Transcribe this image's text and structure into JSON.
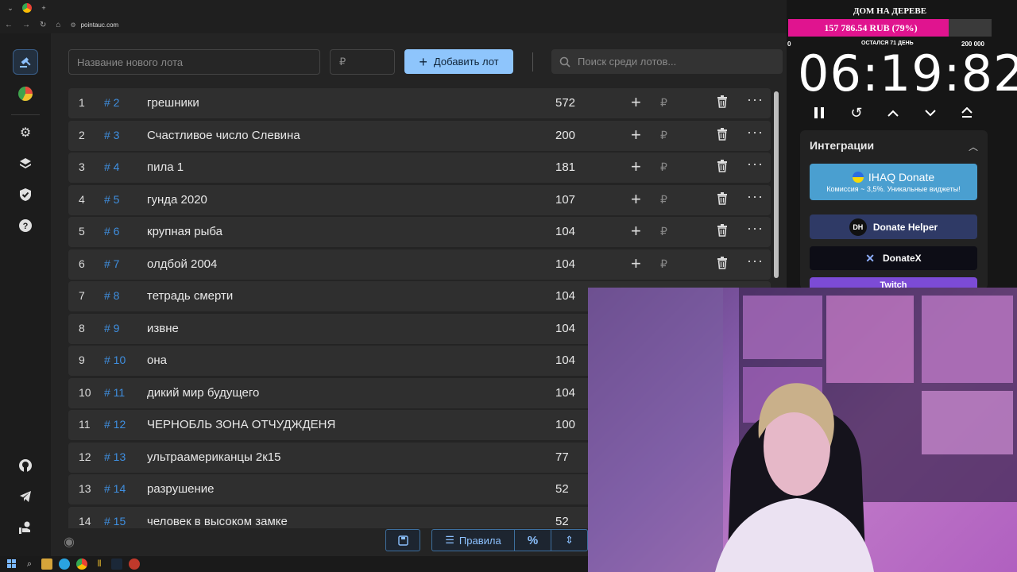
{
  "browser": {
    "url": "pointauc.com"
  },
  "form": {
    "lot_name_placeholder": "Название нового лота",
    "price_placeholder": "₽",
    "add_button_label": "Добавить лот",
    "search_placeholder": "Поиск среди лотов..."
  },
  "lots": [
    {
      "num": "1",
      "id": "# 2",
      "name": "грешники",
      "amount": "572"
    },
    {
      "num": "2",
      "id": "# 3",
      "name": "Счастливое число Слевина",
      "amount": "200"
    },
    {
      "num": "3",
      "id": "# 4",
      "name": "пила 1",
      "amount": "181"
    },
    {
      "num": "4",
      "id": "# 5",
      "name": "гунда 2020",
      "amount": "107"
    },
    {
      "num": "5",
      "id": "# 6",
      "name": "крупная рыба",
      "amount": "104"
    },
    {
      "num": "6",
      "id": "# 7",
      "name": "олдбой 2004",
      "amount": "104"
    },
    {
      "num": "7",
      "id": "# 8",
      "name": "тетрадь смерти",
      "amount": "104"
    },
    {
      "num": "8",
      "id": "# 9",
      "name": "извне",
      "amount": "104"
    },
    {
      "num": "9",
      "id": "# 10",
      "name": "она",
      "amount": "104"
    },
    {
      "num": "10",
      "id": "# 11",
      "name": "дикий мир будущего",
      "amount": "104"
    },
    {
      "num": "11",
      "id": "# 12",
      "name": "ЧЕРНОБЛЬ ЗОНА ОТЧУДЖДЕНЯ",
      "amount": "100"
    },
    {
      "num": "12",
      "id": "# 13",
      "name": "ультраамериканцы 2к15",
      "amount": "77"
    },
    {
      "num": "13",
      "id": "# 14",
      "name": "разрушение",
      "amount": "52"
    },
    {
      "num": "14",
      "id": "# 15",
      "name": "человек в высоком замке",
      "amount": "52"
    }
  ],
  "row_actions": {
    "currency": "₽"
  },
  "toolbar": {
    "rules_label": "Правила",
    "percent_label": "%"
  },
  "donation_goal": {
    "title": "ДОМ НА ДЕРЕВЕ",
    "progress_text": "157 786.54 RUB (79%)",
    "progress_percent": 79,
    "min_label": "0",
    "remaining_label": "ОСТАЛСЯ 71 ДЕНЬ",
    "max_label": "200 000",
    "fill_color": "#e0148f"
  },
  "timer": {
    "display": "06:19:82"
  },
  "integrations": {
    "title": "Интеграции",
    "items": [
      {
        "label": "IHAQ Donate",
        "sublabel": "Комиссия ~ 3,5%. Уникальные виджеты!",
        "color": "#4a9fd0"
      },
      {
        "label": "Donate Helper",
        "color": "#2f3a66"
      },
      {
        "label": "DonateX",
        "color": "#0d0d16"
      },
      {
        "label": "Twitch",
        "color": "#7c4bd6"
      }
    ]
  },
  "colors": {
    "accent": "#8ec5fc",
    "lot_id": "#3f8fe0",
    "background": "#242424"
  }
}
